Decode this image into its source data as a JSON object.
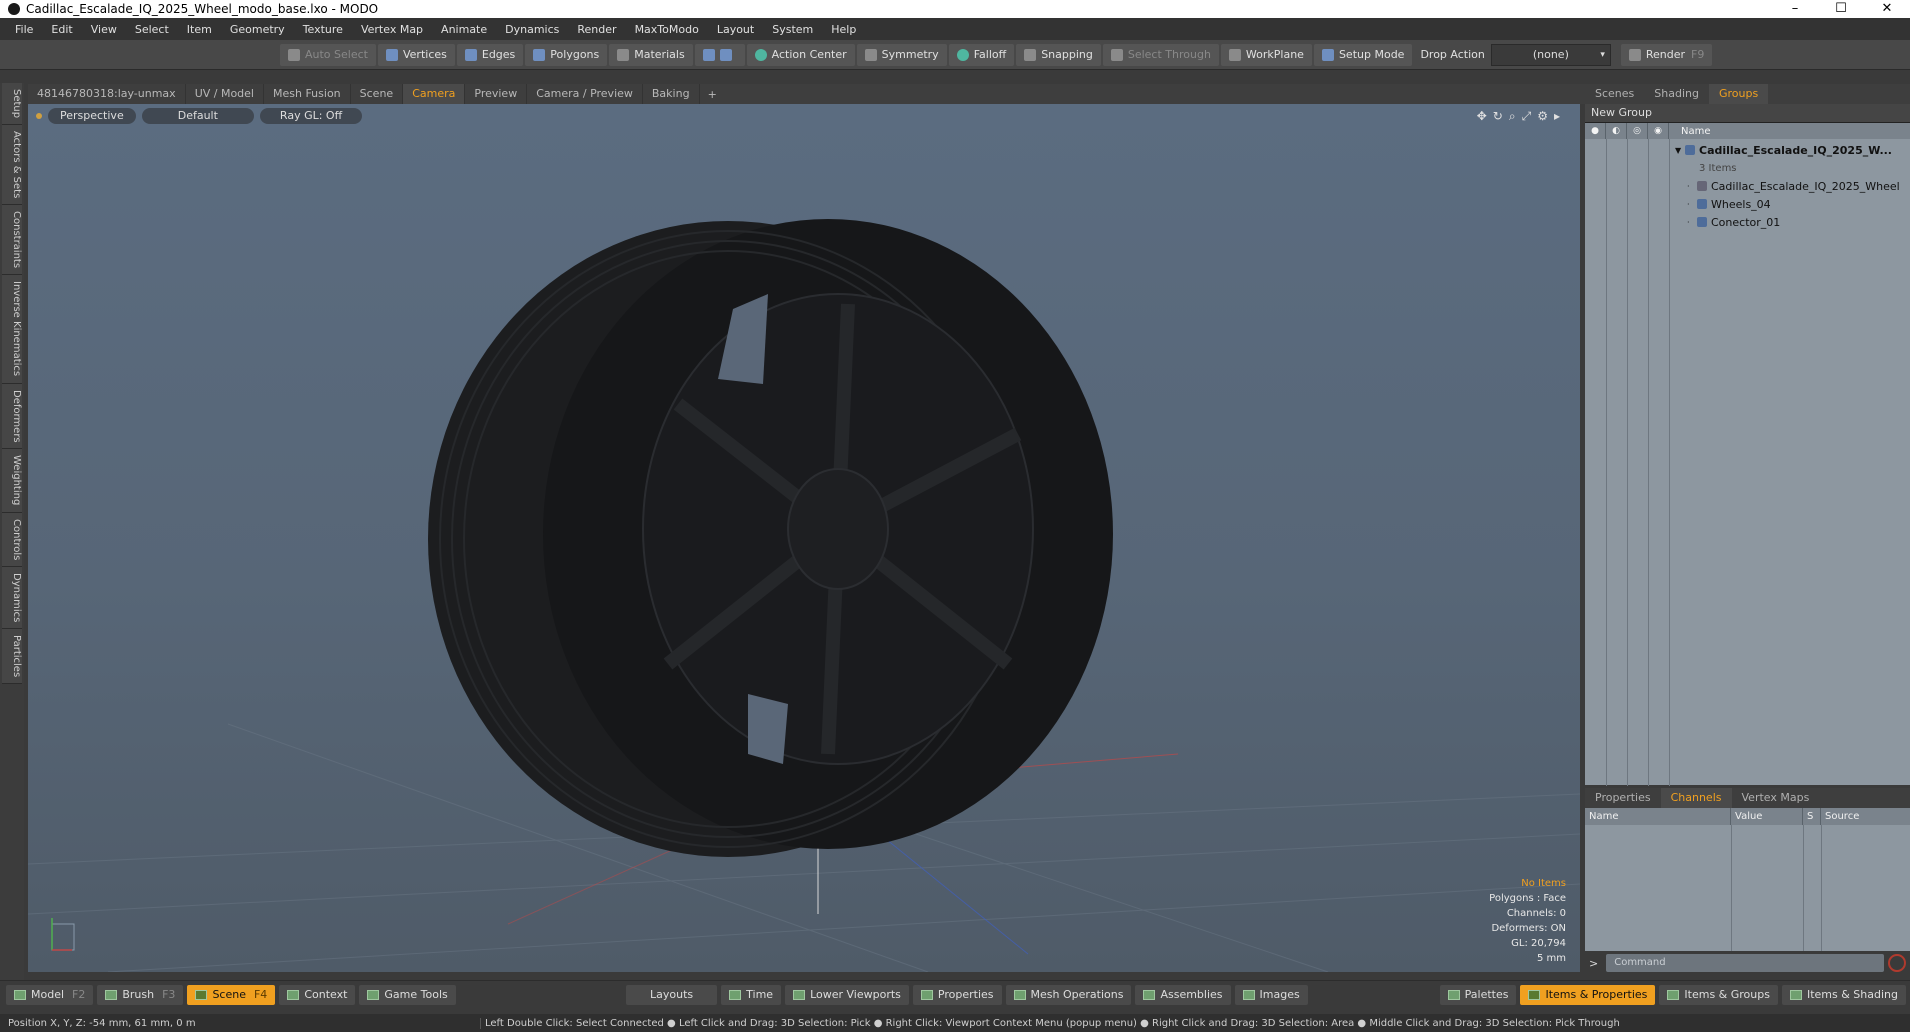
{
  "window": {
    "title": "Cadillac_Escalade_IQ_2025_Wheel_modo_base.lxo - MODO",
    "minimize": "–",
    "maximize": "☐",
    "close": "✕"
  },
  "menu": [
    "File",
    "Edit",
    "View",
    "Select",
    "Item",
    "Geometry",
    "Texture",
    "Vertex Map",
    "Animate",
    "Dynamics",
    "Render",
    "MaxToModo",
    "Layout",
    "System",
    "Help"
  ],
  "toolbar": {
    "auto_select": "Auto Select",
    "vertices": "Vertices",
    "edges": "Edges",
    "polygons": "Polygons",
    "materials": "Materials",
    "action_center": "Action Center",
    "symmetry": "Symmetry",
    "falloff": "Falloff",
    "snapping": "Snapping",
    "select_through": "Select Through",
    "workplane": "WorkPlane",
    "setup_mode": "Setup Mode",
    "drop_action": "Drop Action",
    "drop_value": "(none)",
    "render": "Render",
    "render_key": "F9"
  },
  "left_tabs": [
    "Setup",
    "Actors & Sets",
    "Constraints",
    "Inverse Kinematics",
    "Deformers",
    "Weighting",
    "Controls",
    "Dynamics",
    "Particles"
  ],
  "viewport_tabs": [
    "48146780318:lay-unmax",
    "UV / Model",
    "Mesh Fusion",
    "Scene",
    "Camera",
    "Preview",
    "Camera / Preview",
    "Baking"
  ],
  "viewport_tab_add": "+",
  "viewport": {
    "perspective": "Perspective",
    "shading": "Default",
    "raygl": "Ray GL: Off",
    "info": {
      "items": "No Items",
      "polygons": "Polygons : Face",
      "channels": "Channels: 0",
      "deformers": "Deformers: ON",
      "gl": "GL: 20,794",
      "unit": "5 mm"
    }
  },
  "right_tabs": [
    "Scenes",
    "Shading",
    "Groups"
  ],
  "groups": {
    "new_group": "New Group",
    "name_header": "Name",
    "root": "Cadillac_Escalade_IQ_2025_W...",
    "root_count": "3 Items",
    "children": [
      "Cadillac_Escalade_IQ_2025_Wheel",
      "Wheels_04",
      "Conector_01"
    ]
  },
  "props_tabs": [
    "Properties",
    "Channels",
    "Vertex Maps"
  ],
  "channels": {
    "name": "Name",
    "value": "Value",
    "s": "S",
    "source": "Source"
  },
  "command": {
    "prompt": ">",
    "placeholder": "Command"
  },
  "bottom": {
    "left": [
      {
        "label": "Model",
        "key": "F2"
      },
      {
        "label": "Brush",
        "key": "F3"
      },
      {
        "label": "Scene",
        "key": "F4"
      },
      {
        "label": "Context",
        "key": ""
      },
      {
        "label": "Game Tools",
        "key": ""
      }
    ],
    "mid": [
      "Layouts",
      "Time",
      "Lower Viewports",
      "Properties",
      "Mesh Operations",
      "Assemblies",
      "Images"
    ],
    "right": [
      "Palettes",
      "Items & Properties",
      "Items & Groups",
      "Items & Shading"
    ]
  },
  "status": {
    "position": "Position X, Y, Z:   -54 mm, 61 mm, 0 m",
    "hint": "Left Double Click: Select Connected ● Left Click and Drag: 3D Selection: Pick ● Right Click: Viewport Context Menu (popup menu) ● Right Click and Drag: 3D Selection: Area ● Middle Click and Drag: 3D Selection: Pick Through"
  },
  "colors": {
    "accent": "#f0a020",
    "viewport_top": "#5b6c80",
    "panel": "#8d97a0"
  }
}
